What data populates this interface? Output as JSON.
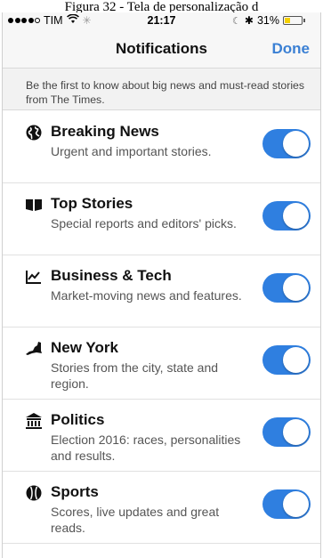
{
  "caption": "Figura 32 - Tela de personalização d",
  "status_bar": {
    "carrier": "TIM",
    "time": "21:17",
    "battery": "31%",
    "battery_level": 0.31
  },
  "nav": {
    "title": "Notifications",
    "done_label": "Done"
  },
  "intro": "Be the first to know about big news and must-read stories from The Times.",
  "colors": {
    "accent": "#3b80d4",
    "toggle_on": "#2f7fe0"
  },
  "items": [
    {
      "icon": "globe-icon",
      "title": "Breaking News",
      "description": "Urgent and important stories.",
      "enabled": true
    },
    {
      "icon": "open-book-icon",
      "title": "Top Stories",
      "description": "Special reports and editors' picks.",
      "enabled": true
    },
    {
      "icon": "line-chart-icon",
      "title": "Business & Tech",
      "description": "Market-moving news and features.",
      "enabled": true
    },
    {
      "icon": "new-york-state-icon",
      "title": "New York",
      "description": "Stories from the city, state and region.",
      "enabled": true
    },
    {
      "icon": "capitol-building-icon",
      "title": "Politics",
      "description": "Election 2016: races, personalities and results.",
      "enabled": true
    },
    {
      "icon": "baseball-icon",
      "title": "Sports",
      "description": "Scores, live updates and great reads.",
      "enabled": true
    }
  ]
}
